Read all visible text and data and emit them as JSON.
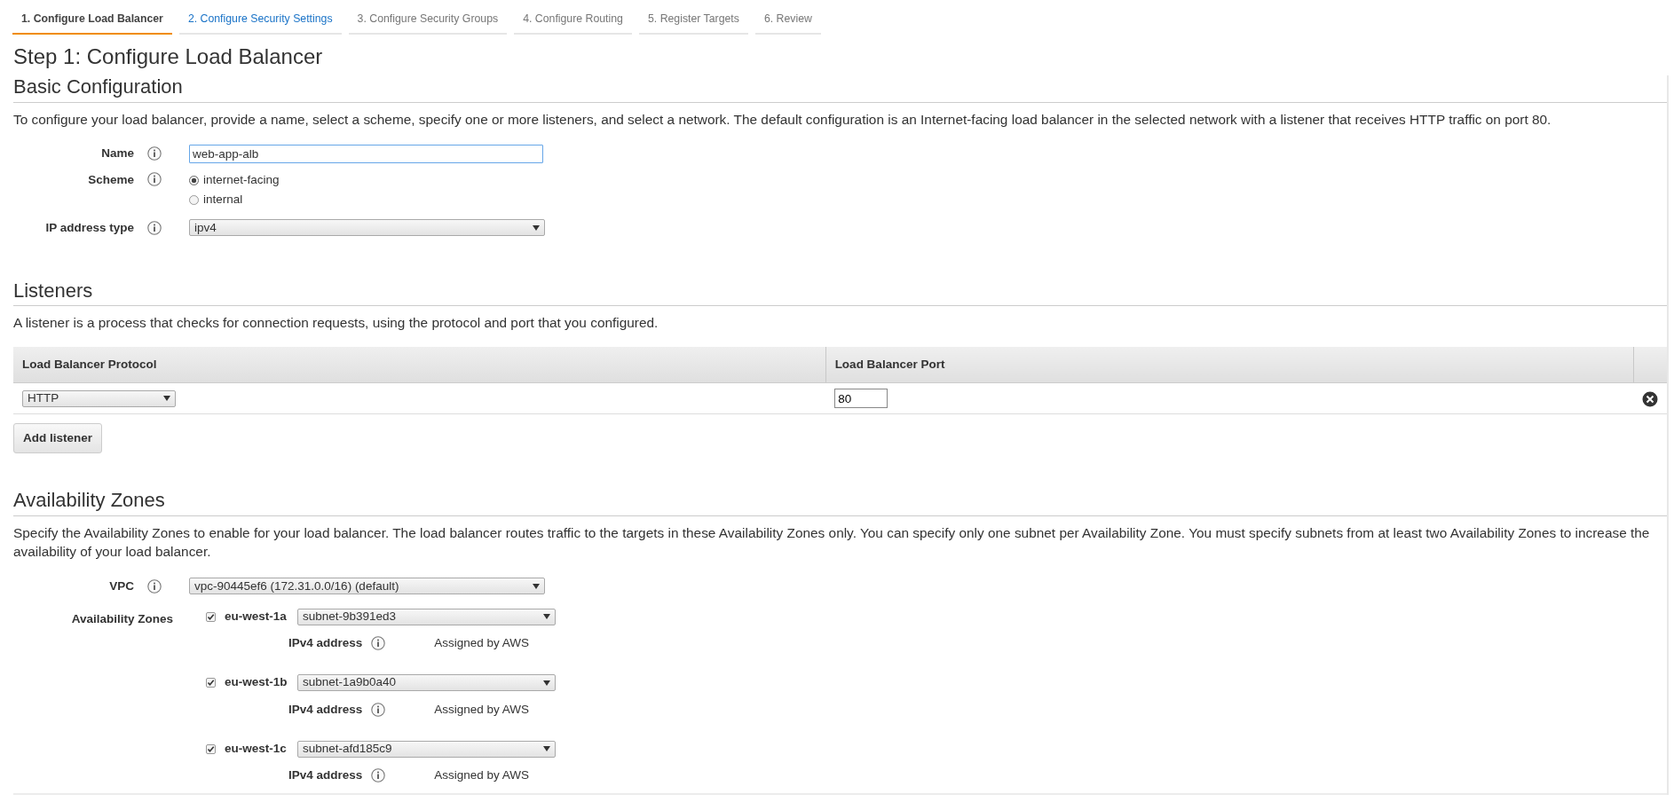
{
  "wizard_steps": [
    {
      "label": "1. Configure Load Balancer",
      "selected": true,
      "available": true
    },
    {
      "label": "2. Configure Security Settings",
      "selected": false,
      "available": true
    },
    {
      "label": "3. Configure Security Groups",
      "selected": false,
      "available": false
    },
    {
      "label": "4. Configure Routing",
      "selected": false,
      "available": false
    },
    {
      "label": "5. Register Targets",
      "selected": false,
      "available": false
    },
    {
      "label": "6. Review",
      "selected": false,
      "available": false
    }
  ],
  "page_title": "Step 1: Configure Load Balancer",
  "basic_configuration": {
    "heading": "Basic Configuration",
    "description": "To configure your load balancer, provide a name, select a scheme, specify one or more listeners, and select a network. The default configuration is an Internet-facing load balancer in the selected network with a listener that receives HTTP traffic on port 80.",
    "name": {
      "label": "Name",
      "value": "web-app-alb"
    },
    "scheme": {
      "label": "Scheme",
      "options": [
        {
          "label": "internet-facing",
          "selected": true
        },
        {
          "label": "internal",
          "selected": false
        }
      ]
    },
    "ip_address_type": {
      "label": "IP address type",
      "value": "ipv4"
    }
  },
  "listeners": {
    "heading": "Listeners",
    "description": "A listener is a process that checks for connection requests, using the protocol and port that you configured.",
    "columns": [
      "Load Balancer Protocol",
      "Load Balancer Port"
    ],
    "rows": [
      {
        "protocol": "HTTP",
        "port": "80"
      }
    ],
    "add_button": "Add listener"
  },
  "availability_zones": {
    "heading": "Availability Zones",
    "description": "Specify the Availability Zones to enable for your load balancer. The load balancer routes traffic to the targets in these Availability Zones only. You can specify only one subnet per Availability Zone. You must specify subnets from at least two Availability Zones to increase the availability of your load balancer.",
    "vpc": {
      "label": "VPC",
      "value": "vpc-90445ef6 (172.31.0.0/16) (default)"
    },
    "zones_label": "Availability Zones",
    "zones": [
      {
        "name": "eu-west-1a",
        "checked": true,
        "subnet": "subnet-9b391ed3",
        "ipv4_label": "IPv4 address",
        "ipv4_value": "Assigned by AWS"
      },
      {
        "name": "eu-west-1b",
        "checked": true,
        "subnet": "subnet-1a9b0a40",
        "ipv4_label": "IPv4 address",
        "ipv4_value": "Assigned by AWS"
      },
      {
        "name": "eu-west-1c",
        "checked": true,
        "subnet": "subnet-afd185c9",
        "ipv4_label": "IPv4 address",
        "ipv4_value": "Assigned by AWS"
      }
    ]
  }
}
